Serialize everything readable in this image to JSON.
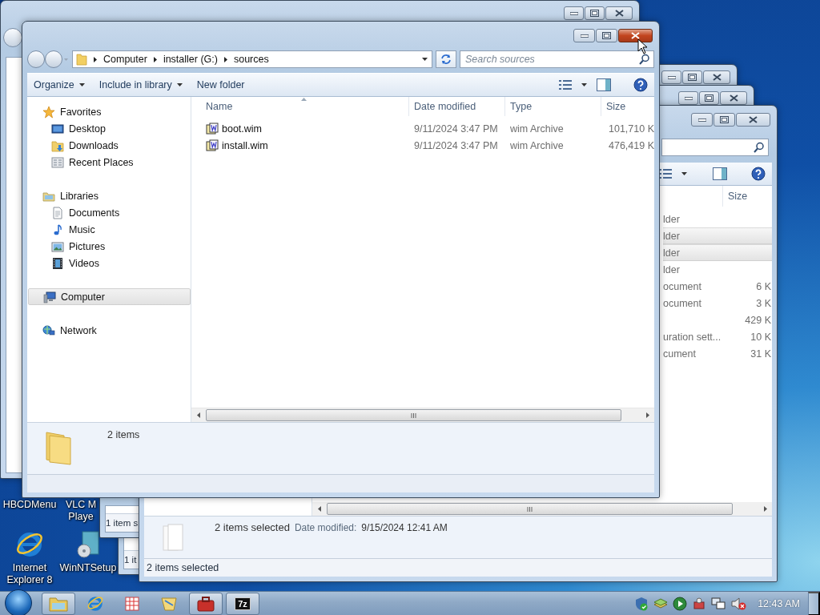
{
  "desktop_icons": [
    {
      "kind": "covered",
      "lines": [
        "HBCDMenu"
      ]
    },
    {
      "kind": "covered",
      "lines": [
        "VLC M",
        "Playe"
      ]
    },
    {
      "kind": "browser",
      "lines": [
        "Internet",
        "Explorer 8"
      ]
    },
    {
      "kind": "setup",
      "lines": [
        "WinNTSetup"
      ]
    }
  ],
  "back_windows": [
    {
      "status": "1 item s"
    },
    {
      "status": "1 it"
    }
  ],
  "right_window": {
    "column": "Size",
    "rows": [
      {
        "type": "lder",
        "selected": false
      },
      {
        "type": "lder",
        "selected": true
      },
      {
        "type": "lder",
        "selected": true
      },
      {
        "type": "lder",
        "selected": false
      },
      {
        "type": "ocument",
        "size": "6 K",
        "selected": false
      },
      {
        "type": "ocument",
        "size": "3 K",
        "selected": false
      },
      {
        "size": "429 K",
        "selected": false
      },
      {
        "type": "uration sett...",
        "size": "10 K",
        "selected": false
      },
      {
        "type": "cument",
        "size": "31 K",
        "selected": false
      }
    ],
    "details": {
      "summary": "2 items selected",
      "label": "Date modified:",
      "value": "9/15/2024 12:41 AM"
    },
    "status": "2 items selected"
  },
  "main_window": {
    "close_hovered": true,
    "address": [
      "Computer",
      "installer (G:)",
      "sources"
    ],
    "search": {
      "placeholder": "Search sources"
    },
    "toolbar": [
      {
        "label": "Organize",
        "dropdown": true
      },
      {
        "label": "Include in library",
        "dropdown": true
      },
      {
        "label": "New folder",
        "dropdown": false
      }
    ],
    "nav": [
      {
        "label": "Favorites",
        "kind": "favorites",
        "selected": false,
        "children": [
          {
            "label": "Desktop",
            "kind": "desktop",
            "selected": false
          },
          {
            "label": "Downloads",
            "kind": "downloads",
            "selected": false
          },
          {
            "label": "Recent Places",
            "kind": "recent",
            "selected": false
          }
        ]
      },
      {
        "label": "Libraries",
        "kind": "library",
        "selected": false,
        "children": [
          {
            "label": "Documents",
            "kind": "document",
            "selected": false
          },
          {
            "label": "Music",
            "kind": "music",
            "selected": false
          },
          {
            "label": "Pictures",
            "kind": "pictures",
            "selected": false
          },
          {
            "label": "Videos",
            "kind": "videos",
            "selected": false
          }
        ]
      },
      {
        "label": "Computer",
        "kind": "computer",
        "selected": true
      },
      {
        "label": "Network",
        "kind": "network",
        "selected": false
      }
    ],
    "columns": [
      "Name",
      "Date modified",
      "Type",
      "Size"
    ],
    "files": [
      {
        "name": "boot.wim",
        "date": "9/11/2024 3:47 PM",
        "type": "wim Archive",
        "size": "101,710 K",
        "selected": false
      },
      {
        "name": "install.wim",
        "date": "9/11/2024 3:47 PM",
        "type": "wim Archive",
        "size": "476,419 K",
        "selected": false
      }
    ],
    "details": "2 items"
  },
  "taskbar": {
    "buttons": [
      {
        "kind": "explorer",
        "running": true
      },
      {
        "kind": "ie",
        "running": false
      },
      {
        "kind": "grid",
        "running": false
      },
      {
        "kind": "bird",
        "running": false
      },
      {
        "kind": "case",
        "running": true
      },
      {
        "kind": "archiver",
        "label": "7z",
        "running": true
      }
    ],
    "tray": [
      {
        "kind": "shield"
      },
      {
        "kind": "stack"
      },
      {
        "kind": "play"
      },
      {
        "kind": "tool"
      },
      {
        "kind": "network"
      },
      {
        "kind": "muted"
      }
    ],
    "clock": "12:43 AM"
  }
}
